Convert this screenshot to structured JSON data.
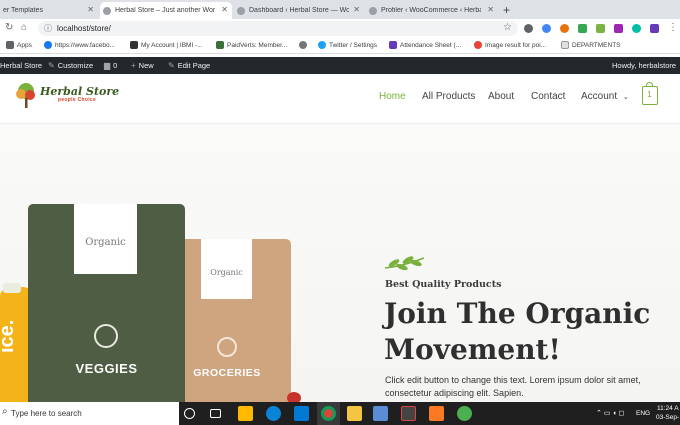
{
  "browser": {
    "tabs": [
      {
        "title": "er Templates",
        "active": false
      },
      {
        "title": "Herbal Store – Just another Wor",
        "active": true
      },
      {
        "title": "Dashboard ‹ Herbal Store — Wo",
        "active": false
      },
      {
        "title": "Profiler ‹ WooCommerce ‹ Herba",
        "active": false
      }
    ],
    "new_tab": "+",
    "url": "localhost/store/",
    "bookmarks": [
      {
        "label": "Apps",
        "icon": "apps-grid-icon"
      },
      {
        "label": "https://www.facebo...",
        "icon": "facebook-icon"
      },
      {
        "label": "My Account | IBMI -...",
        "icon": "ibmi-icon"
      },
      {
        "label": "PaidVerts: Member...",
        "icon": "paidverts-icon"
      },
      {
        "label": "",
        "icon": "globe-icon"
      },
      {
        "label": "Twitter / Settings",
        "icon": "twitter-icon"
      },
      {
        "label": "Attendance Sheet (...",
        "icon": "sheet-icon"
      },
      {
        "label": "Image result for poi...",
        "icon": "google-icon"
      },
      {
        "label": "DEPARTMENTS",
        "icon": "document-icon"
      }
    ]
  },
  "adminbar": {
    "site": "Herbal Store",
    "customize": "Customize",
    "comments": "0",
    "new": "New",
    "edit": "Edit Page",
    "howdy": "Howdy, herbalstore"
  },
  "site": {
    "logo_title": "Herbal Store",
    "logo_tagline": "people Choice",
    "nav": [
      "Home",
      "All Products",
      "About",
      "Contact",
      "Account"
    ],
    "cart_count": "1"
  },
  "hero": {
    "bag1_brand": "Organic",
    "bag1_label": "VEGGIES",
    "bag2_brand": "Organic",
    "bag2_label": "GROCERIES",
    "bottle_text": "ice.",
    "kicker": "Best Quality Products",
    "title": "Join The Organic Movement!",
    "body": "Click edit button to change this text. Lorem ipsum dolor sit amet, consectetur adipiscing elit. Sapien."
  },
  "taskbar": {
    "search_placeholder": "Type here to search",
    "language": "ENG",
    "time": "11:24 A",
    "date": "03-Sep-"
  },
  "colors": {
    "accent_green": "#7ab03c",
    "admin_bar": "#23282d",
    "bag_green": "#4f5d45",
    "bag_kraft": "#cfa580"
  }
}
